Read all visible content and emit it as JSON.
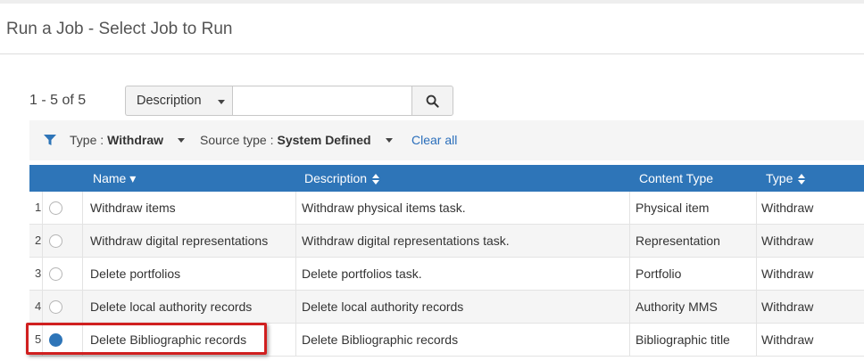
{
  "page": {
    "title": "Run a Job - Select Job to Run"
  },
  "pager": {
    "text": "1 - 5 of 5"
  },
  "search": {
    "field": "Description",
    "value": "",
    "placeholder": ""
  },
  "filters": {
    "type_label": "Type :",
    "type_value": "Withdraw",
    "source_label": "Source type :",
    "source_value": "System Defined",
    "clear_all": "Clear all"
  },
  "table": {
    "columns": {
      "name": "Name ▾",
      "description": "Description",
      "content_type": "Content Type",
      "type": "Type"
    },
    "rows": [
      {
        "num": "1",
        "name": "Withdraw items",
        "description": "Withdraw physical items task.",
        "content_type": "Physical item",
        "type": "Withdraw",
        "selected": false
      },
      {
        "num": "2",
        "name": "Withdraw digital representations",
        "description": "Withdraw digital representations task.",
        "content_type": "Representation",
        "type": "Withdraw",
        "selected": false
      },
      {
        "num": "3",
        "name": "Delete portfolios",
        "description": "Delete portfolios task.",
        "content_type": "Portfolio",
        "type": "Withdraw",
        "selected": false
      },
      {
        "num": "4",
        "name": "Delete local authority records",
        "description": "Delete local authority records",
        "content_type": "Authority MMS",
        "type": "Withdraw",
        "selected": false
      },
      {
        "num": "5",
        "name": "Delete Bibliographic records",
        "description": "Delete Bibliographic records",
        "content_type": "Bibliographic title",
        "type": "Withdraw",
        "selected": true
      }
    ]
  },
  "colors": {
    "header_blue": "#2e75b8",
    "link_blue": "#2a6ebb",
    "highlight_red": "#d01f1f"
  },
  "icons": {
    "search": "search-icon",
    "filter": "filter-icon",
    "sort": "sort-icon"
  }
}
